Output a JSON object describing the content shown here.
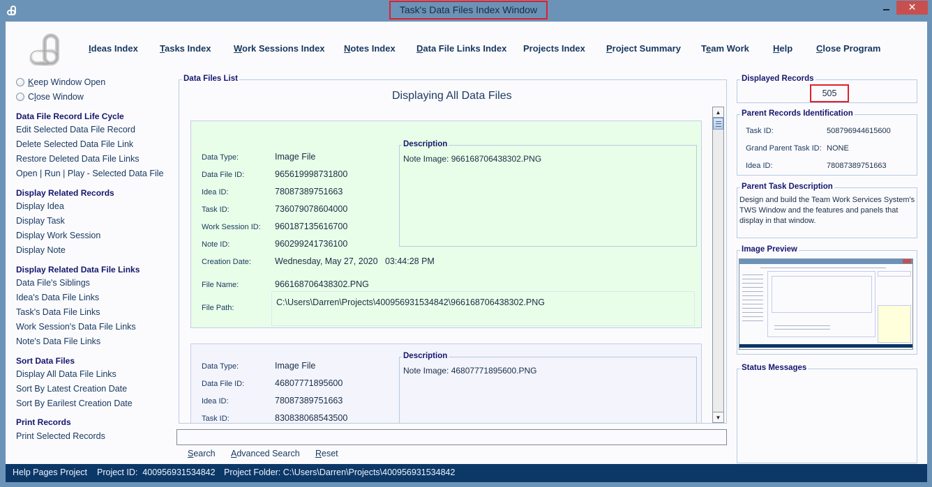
{
  "window": {
    "title": "Task's Data Files Index Window",
    "minimize": "▁",
    "maximize": "☐",
    "close": "✕"
  },
  "nav": [
    {
      "label": "Ideas Index",
      "mnemonic": "I",
      "rest": "deas Index"
    },
    {
      "label": "Tasks Index",
      "mnemonic": "T",
      "rest": "asks Index"
    },
    {
      "label": "Work Sessions Index",
      "mnemonic": "W",
      "rest": "ork Sessions Index"
    },
    {
      "label": "Notes Index",
      "mnemonic": "N",
      "rest": "otes Index"
    },
    {
      "label": "Data File Links Index",
      "mnemonic": "D",
      "rest": "ata File Links Index"
    },
    {
      "label": "Projects Index",
      "mnemonic": "",
      "rest": "Projects Index"
    },
    {
      "label": "Project Summary",
      "mnemonic": "P",
      "rest": "roject Summary"
    },
    {
      "label": "Team Work",
      "pre": "T",
      "mnemonic": "e",
      "rest": "am Work"
    },
    {
      "label": "Help",
      "mnemonic": "H",
      "rest": "elp"
    },
    {
      "label": "Close Program",
      "mnemonic": "C",
      "rest": "lose Program"
    }
  ],
  "sidebar": {
    "radio_keep": {
      "pre": "",
      "mnemonic": "K",
      "rest": "eep Window Open"
    },
    "radio_close": {
      "pre": "C",
      "mnemonic": "l",
      "rest": "ose Window"
    },
    "sections": [
      {
        "title": "Data File Record Life Cycle",
        "items": [
          "Edit Selected Data File Record",
          "Delete Selected Data File Link",
          "Restore Deleted Data File Links",
          "Open | Run | Play - Selected Data File"
        ]
      },
      {
        "title": "Display Related Records",
        "items": [
          "Display Idea",
          "Display Task",
          "Display Work Session",
          "Display Note"
        ]
      },
      {
        "title": "Display Related Data File Links",
        "items": [
          "Data File's Siblings",
          "Idea's Data File Links",
          "Task's Data File Links",
          "Work Session's Data File Links",
          "Note's Data File Links"
        ]
      },
      {
        "title": "Sort Data Files",
        "items": [
          "Display All Data File Links",
          "Sort By Latest Creation Date",
          "Sort By Earilest Creation Date"
        ]
      },
      {
        "title": "Print Records",
        "items": [
          "Print Selected Records"
        ]
      }
    ]
  },
  "list": {
    "group_title": "Data Files List",
    "heading": "Displaying All Data Files",
    "labels": {
      "data_type": "Data Type:",
      "data_file_id": "Data File ID:",
      "idea_id": "Idea ID:",
      "task_id": "Task ID:",
      "work_session_id": "Work Session ID:",
      "note_id": "Note ID:",
      "creation_date": "Creation Date:",
      "file_name": "File Name:",
      "file_path": "File Path:",
      "description": "Description"
    },
    "records": [
      {
        "data_type": "Image File",
        "data_file_id": "965619998731800",
        "idea_id": "78087389751663",
        "task_id": "736079078604000",
        "work_session_id": "960187135616700",
        "note_id": "960299241736100",
        "creation_date": "Wednesday, May 27, 2020   03:44:28 PM",
        "file_name": "966168706438302.PNG",
        "file_path": "C:\\Users\\Darren\\Projects\\400956931534842\\966168706438302.PNG",
        "description": "Note Image: 966168706438302.PNG"
      },
      {
        "data_type": "Image File",
        "data_file_id": "46807771895600",
        "idea_id": "78087389751663",
        "task_id": "830838068543500",
        "description": "Note Image: 46807771895600.PNG"
      }
    ]
  },
  "search": {
    "value": "",
    "search": {
      "mnemonic": "S",
      "rest": "earch"
    },
    "advanced": {
      "mnemonic": "A",
      "rest": "dvanced Search"
    },
    "reset": {
      "mnemonic": "R",
      "rest": "eset"
    }
  },
  "right": {
    "displayed_records_title": "Displayed Records",
    "displayed_records": "505",
    "parent_title": "Parent Records Identification",
    "parent": [
      {
        "label": "Task ID:",
        "value": "508796944615600"
      },
      {
        "label": "Grand Parent Task ID:",
        "value": "NONE"
      },
      {
        "label": "Idea ID:",
        "value": "78087389751663"
      }
    ],
    "task_desc_title": "Parent Task Description",
    "task_desc": "Design and build the Team Work Services System's TWS Window and the features and panels that display in that window.",
    "preview_title": "Image Preview",
    "status_title": "Status Messages"
  },
  "statusbar": {
    "project": "Help Pages Project",
    "project_id": "Project ID:  400956931534842",
    "folder": "Project Folder: C:\\Users\\Darren\\Projects\\400956931534842"
  }
}
